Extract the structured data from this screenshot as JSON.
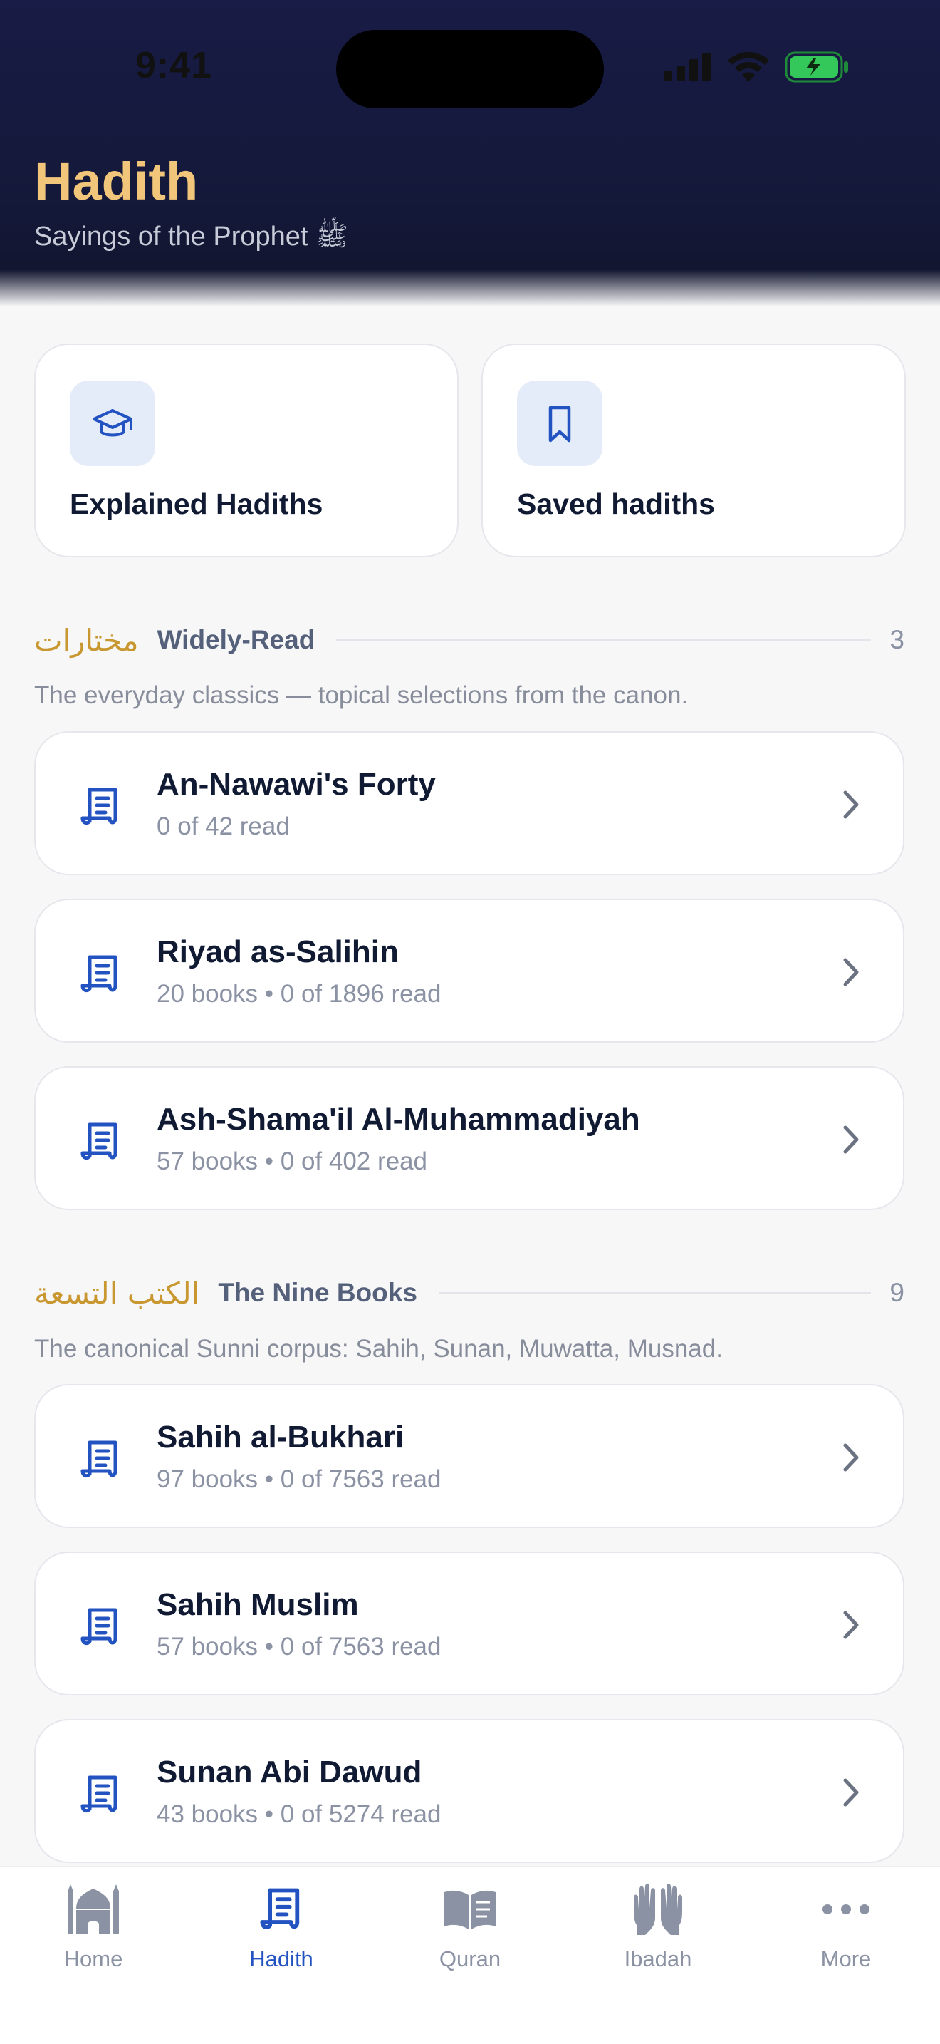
{
  "status_bar": {
    "time": "9:41"
  },
  "header": {
    "title": "Hadith",
    "subtitle": "Sayings of the Prophet ﷺ"
  },
  "quick_actions": [
    {
      "label": "Explained Hadiths",
      "icon": "graduation-cap-icon"
    },
    {
      "label": "Saved hadiths",
      "icon": "bookmark-icon"
    }
  ],
  "sections": [
    {
      "arabic": "مختارات",
      "name": "Widely-Read",
      "count": "3",
      "description": "The everyday classics — topical selections from the canon.",
      "items": [
        {
          "title": "An-Nawawi's Forty",
          "subtitle": "0 of 42 read"
        },
        {
          "title": "Riyad as-Salihin",
          "subtitle": "20 books • 0 of 1896 read"
        },
        {
          "title": "Ash-Shama'il Al-Muhammadiyah",
          "subtitle": "57 books • 0 of 402 read"
        }
      ]
    },
    {
      "arabic": "الكتب التسعة",
      "name": "The Nine Books",
      "count": "9",
      "description": "The canonical Sunni corpus: Sahih, Sunan, Muwatta, Musnad.",
      "items": [
        {
          "title": "Sahih al-Bukhari",
          "subtitle": "97 books • 0 of 7563 read"
        },
        {
          "title": "Sahih Muslim",
          "subtitle": "57 books • 0 of 7563 read"
        },
        {
          "title": "Sunan Abi Dawud",
          "subtitle": "43 books • 0 of 5274 read"
        }
      ]
    }
  ],
  "tabbar": {
    "active": "Hadith",
    "tabs": [
      {
        "label": "Home",
        "icon": "mosque-icon"
      },
      {
        "label": "Hadith",
        "icon": "scroll-icon"
      },
      {
        "label": "Quran",
        "icon": "open-book-icon"
      },
      {
        "label": "Ibadah",
        "icon": "praying-hands-icon"
      },
      {
        "label": "More",
        "icon": "more-dots-icon"
      }
    ]
  },
  "colors": {
    "header_bg": "#181c46",
    "title_gold": "#f2c67a",
    "arabic_gold": "#c8972f",
    "accent_blue": "#2353c1",
    "icon_tile_bg": "#e5ecf9",
    "battery_green": "#34c759"
  }
}
